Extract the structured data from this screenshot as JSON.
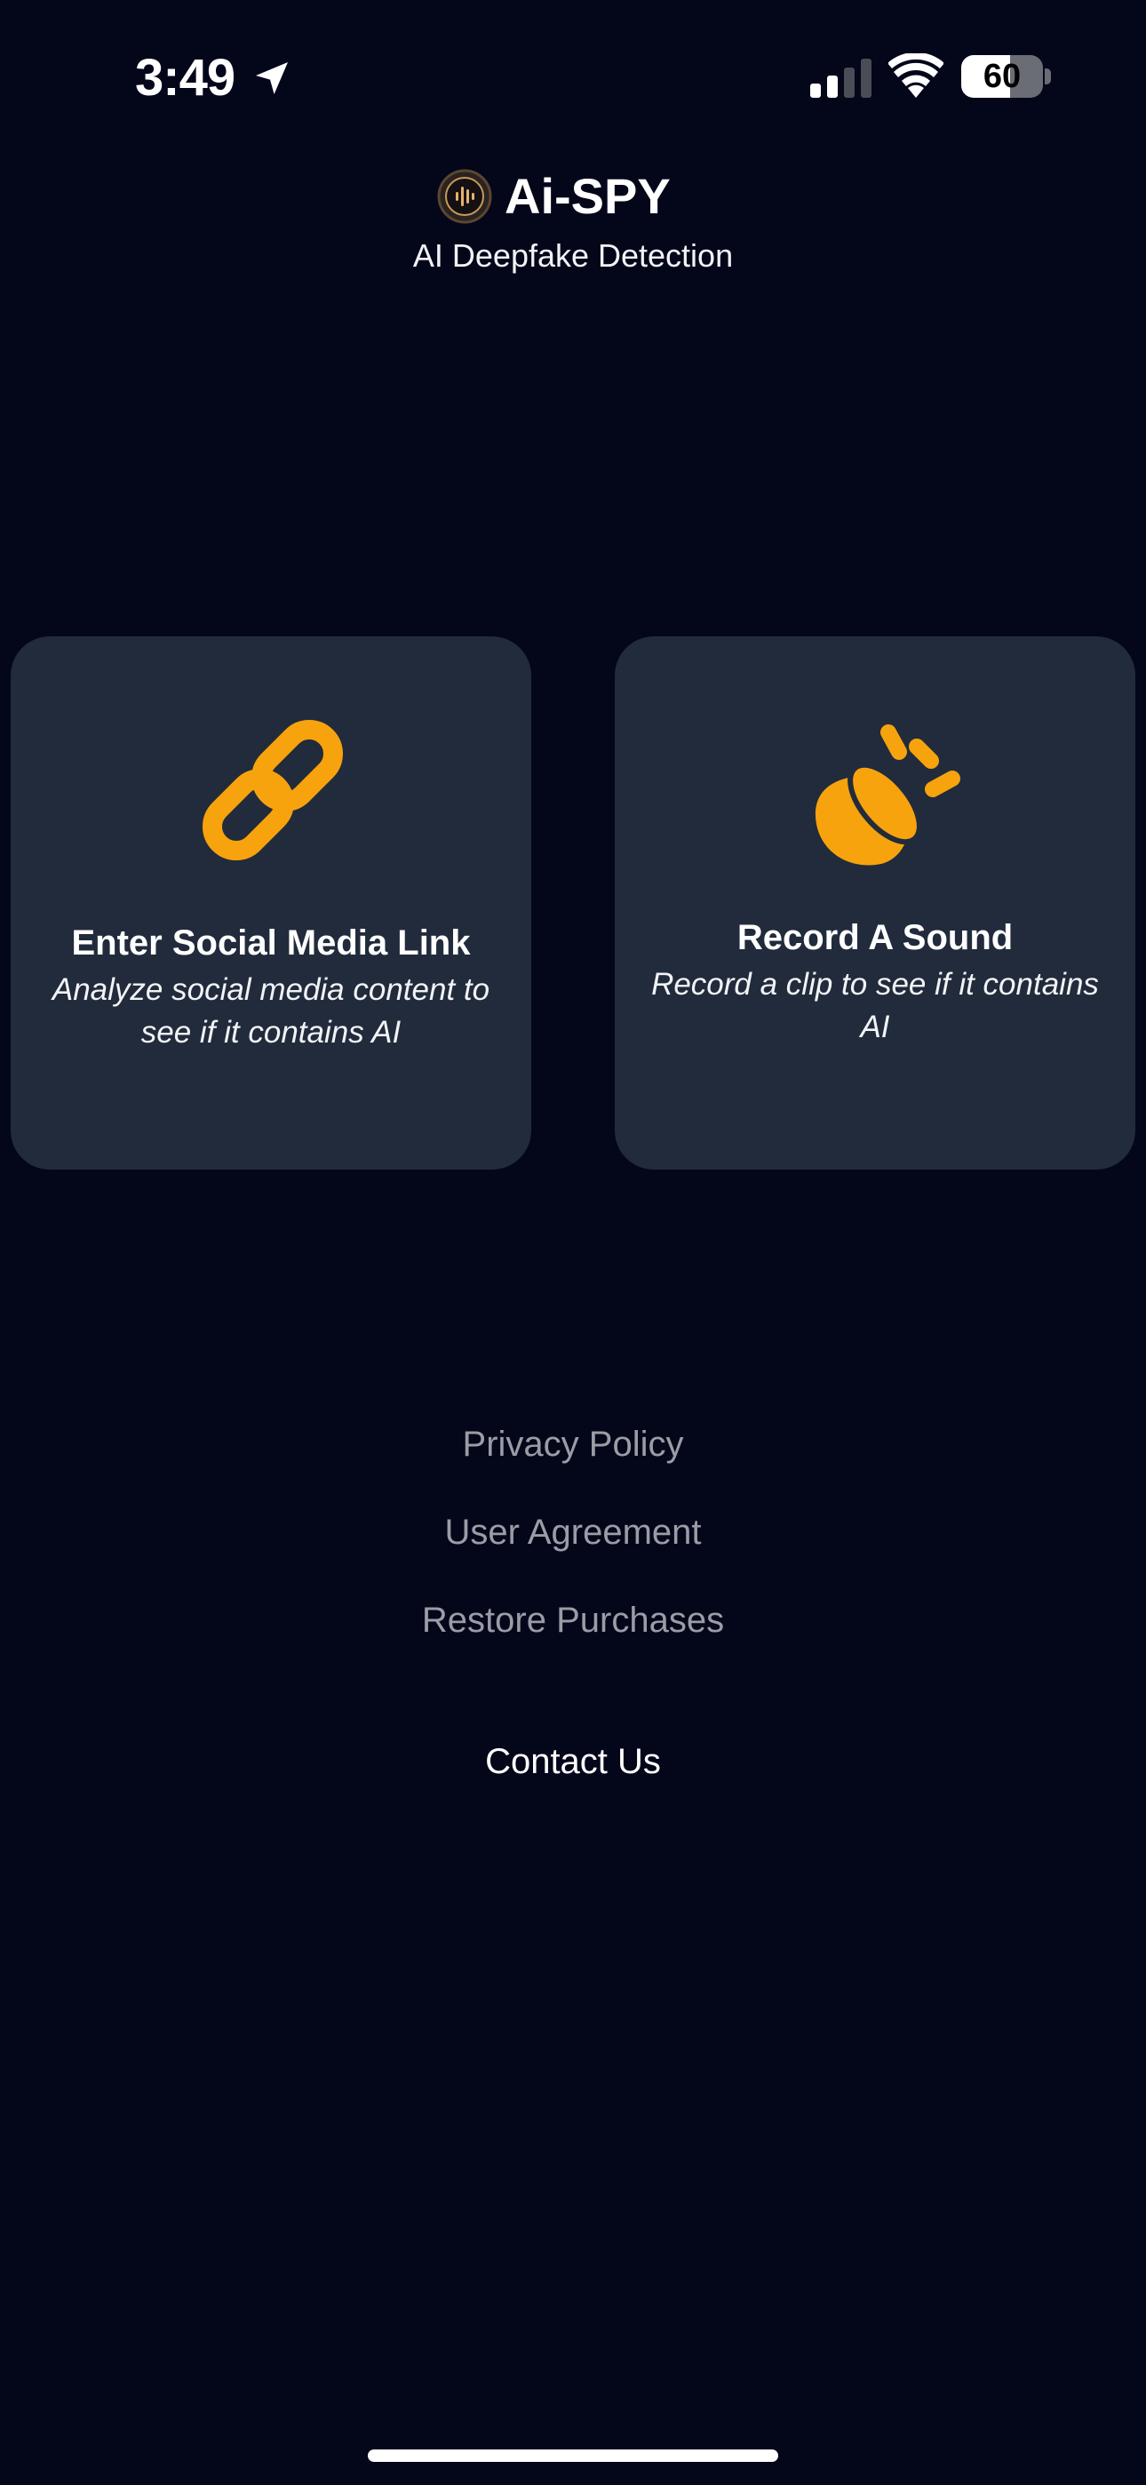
{
  "status_bar": {
    "time": "3:49",
    "battery_level": "60",
    "battery_fraction": 0.6,
    "icons": [
      "location-arrow-icon",
      "cellular-signal-icon",
      "wifi-icon",
      "battery-icon"
    ]
  },
  "header": {
    "title": "Ai-SPY",
    "subtitle": "AI Deepfake Detection",
    "logo_icon": "ai-spy-logo-icon"
  },
  "cards": [
    {
      "id": "social-link",
      "icon": "link-chain-icon",
      "title": "Enter Social Media Link",
      "description": "Analyze social media content to see if it contains AI"
    },
    {
      "id": "record-sound",
      "icon": "megaphone-sound-icon",
      "title": "Record A Sound",
      "description": "Record a clip to see if it contains AI"
    }
  ],
  "footer": {
    "privacy": "Privacy Policy",
    "agreement": "User Agreement",
    "restore": "Restore Purchases",
    "contact": "Contact Us"
  },
  "colors": {
    "background": "#04061a",
    "card": "#212b3c",
    "accent": "#f7a30d",
    "muted_text": "#9a9ca6"
  }
}
